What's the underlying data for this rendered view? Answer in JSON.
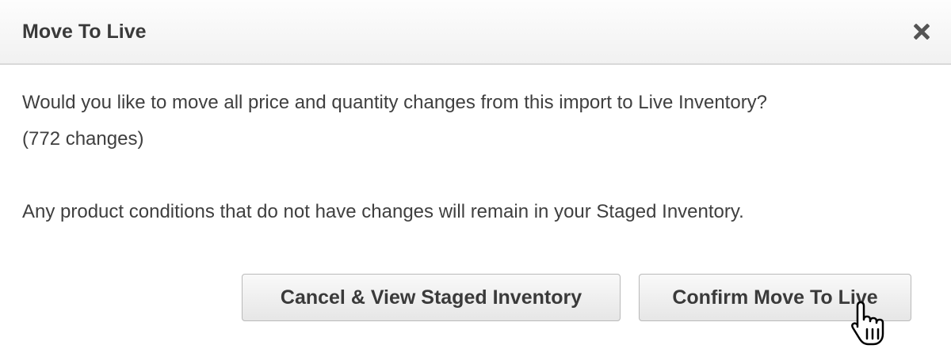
{
  "dialog": {
    "title": "Move To Live",
    "close_icon": "close-x-icon",
    "message_line_1": "Would you like to move all price and quantity changes from this import to Live Inventory?",
    "message_line_2": "(772 changes)",
    "message_line_3": "Any product conditions that do not have changes will remain in your Staged Inventory.",
    "cancel_label": "Cancel & View Staged Inventory",
    "confirm_label": "Confirm Move To Live"
  },
  "pointer": {
    "icon": "hand-pointer-cursor-icon"
  },
  "colors": {
    "header_bg": "#f1f1f1",
    "text": "#3f3f3f",
    "title_text": "#3a3a3a",
    "button_border": "#b9b9b9"
  }
}
